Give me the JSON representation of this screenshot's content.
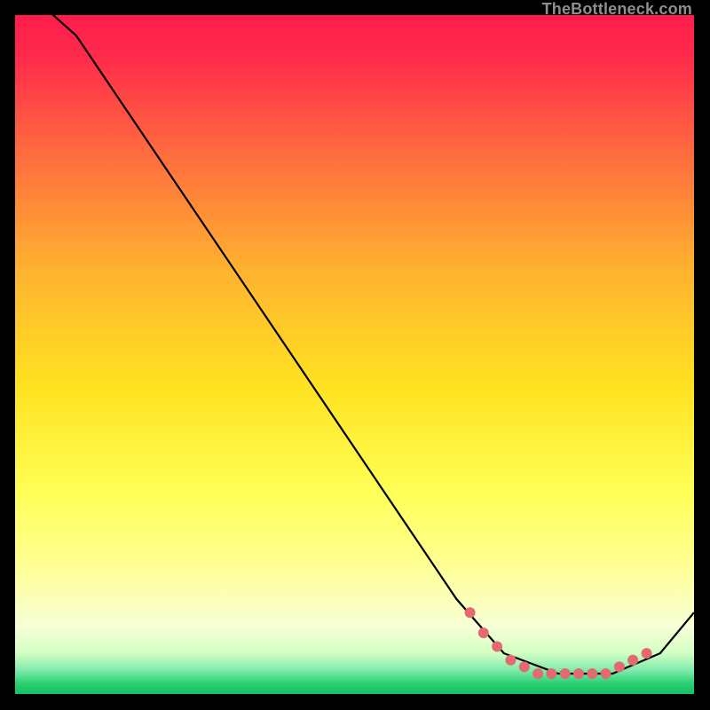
{
  "attribution": "TheBottleneck.com",
  "colors": {
    "frame": "#000000",
    "line": "#000000",
    "marker": "#e46a6f",
    "top_gradient": "#ff1d4b",
    "mid_gradient": "#ffe321",
    "low_gradient": "#f7ffd6",
    "bottom_gradient": "#27ce6f"
  },
  "chart_data": {
    "type": "line",
    "title": "",
    "xlabel": "",
    "ylabel": "",
    "xlim": [
      0,
      100
    ],
    "ylim": [
      0,
      100
    ],
    "grid": false,
    "curve": {
      "x": [
        0,
        9,
        65,
        72,
        80,
        88,
        95,
        100
      ],
      "y": [
        105,
        97,
        14,
        6,
        3,
        3,
        6,
        12
      ]
    },
    "markers": {
      "x": [
        67,
        69,
        71,
        73,
        75,
        77,
        79,
        81,
        83,
        85,
        87,
        89,
        91,
        93
      ],
      "y": [
        12,
        9,
        7,
        5,
        4,
        3,
        3,
        3,
        3,
        3,
        3,
        4,
        5,
        6
      ]
    }
  }
}
